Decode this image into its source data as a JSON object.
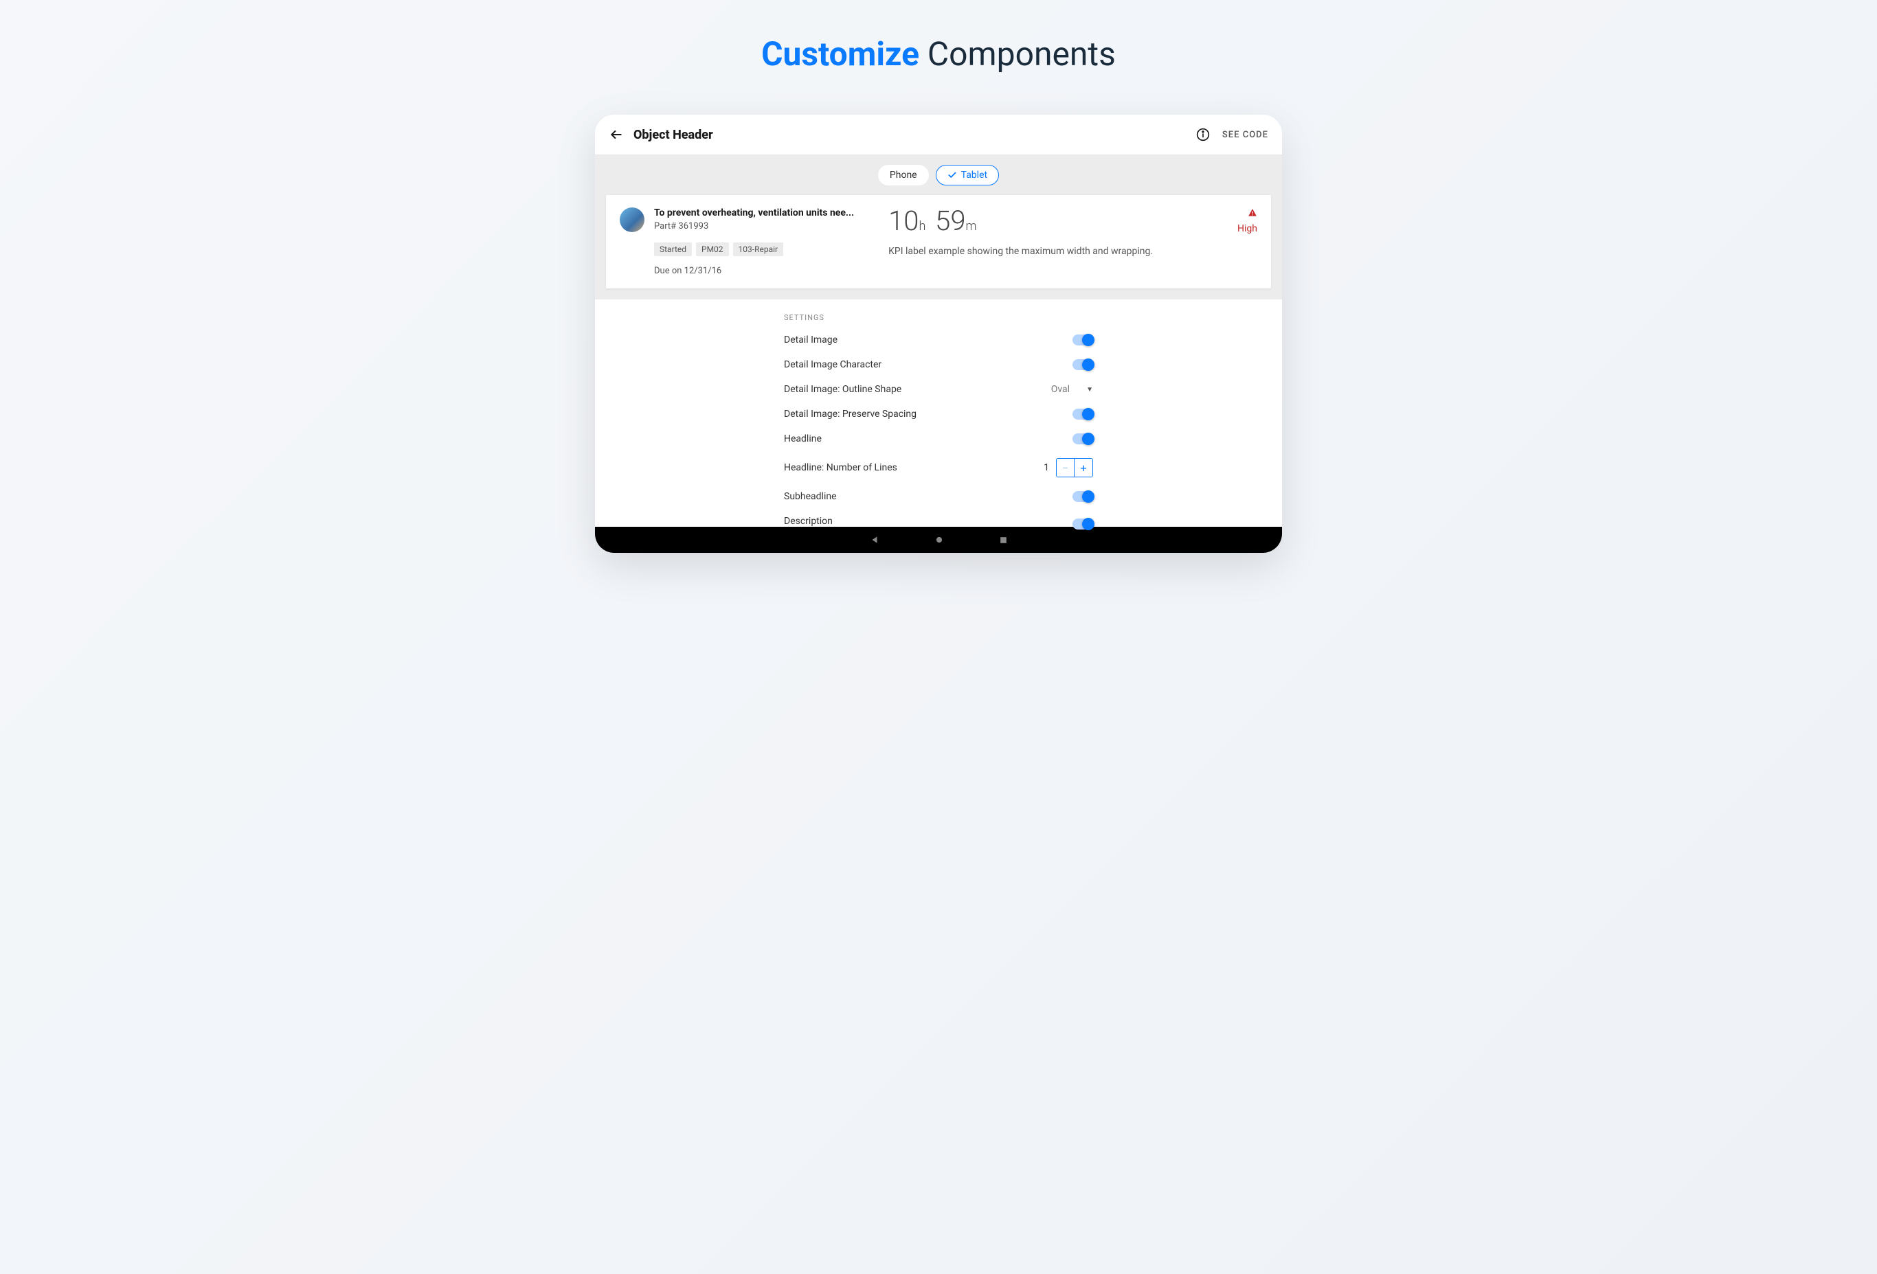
{
  "title": {
    "accent": "Customize",
    "rest": "Components"
  },
  "header": {
    "title": "Object Header",
    "see_code": "SEE CODE"
  },
  "device_tabs": {
    "phone": "Phone",
    "tablet": "Tablet"
  },
  "preview": {
    "headline": "To prevent overheating, ventilation units nee...",
    "subheadline": "Part# 361993",
    "tags": [
      "Started",
      "PM02",
      "103-Repair"
    ],
    "due": "Due on 12/31/16",
    "kpi_h": "10",
    "kpi_h_unit": "h",
    "kpi_m": "59",
    "kpi_m_unit": "m",
    "kpi_label": "KPI label example showing the maximum width and wrapping.",
    "status": "High"
  },
  "settings": {
    "heading": "SETTINGS",
    "rows": {
      "detail_image": "Detail Image",
      "detail_image_char": "Detail Image Character",
      "outline_shape_label": "Detail Image: Outline Shape",
      "outline_shape_value": "Oval",
      "preserve_spacing": "Detail Image: Preserve Spacing",
      "headline": "Headline",
      "headline_lines_label": "Headline: Number of Lines",
      "headline_lines_value": "1",
      "subheadline": "Subheadline",
      "description": "Description"
    }
  }
}
